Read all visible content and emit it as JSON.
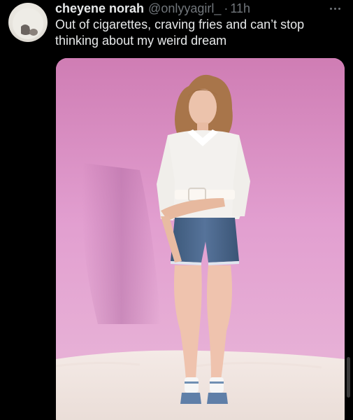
{
  "tweet": {
    "display_name": "cheyene norah",
    "handle": "@onlyyagirl_",
    "separator": "·",
    "time": "11h",
    "text": "Out of cigarettes, craving fries and can’t stop thinking about my weird dream"
  },
  "icons": {
    "more": "more-horizontal-icon"
  },
  "colors": {
    "background": "#000000",
    "text_primary": "#e7e9ea",
    "text_secondary": "#71767b",
    "backdrop_pink": "#dd94c7"
  }
}
